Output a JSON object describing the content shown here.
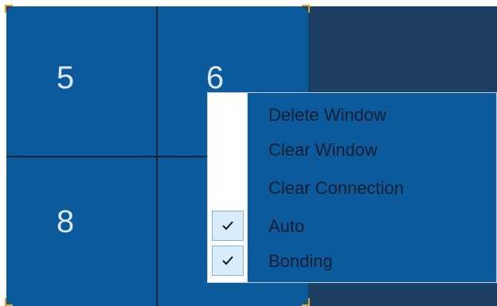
{
  "grid": {
    "cells": [
      {
        "label": "5"
      },
      {
        "label": "6"
      },
      {
        "label": "8"
      }
    ]
  },
  "context_menu": {
    "items": [
      {
        "label": "Delete Window",
        "checked": false
      },
      {
        "label": "Clear Window",
        "checked": false
      },
      {
        "label": "Clear Connection",
        "checked": false
      },
      {
        "label": "Auto",
        "checked": true
      },
      {
        "label": "Bonding",
        "checked": true
      }
    ]
  },
  "colors": {
    "grid_fill": "#0a5a9c",
    "background": "#1d3f63",
    "corner_marker": "#e0a020",
    "cell_text": "#dfe7ef",
    "menu_text": "#0d1e2f"
  },
  "icons": {
    "check": "checkmark-icon",
    "corner": "corner-marker-icon"
  }
}
